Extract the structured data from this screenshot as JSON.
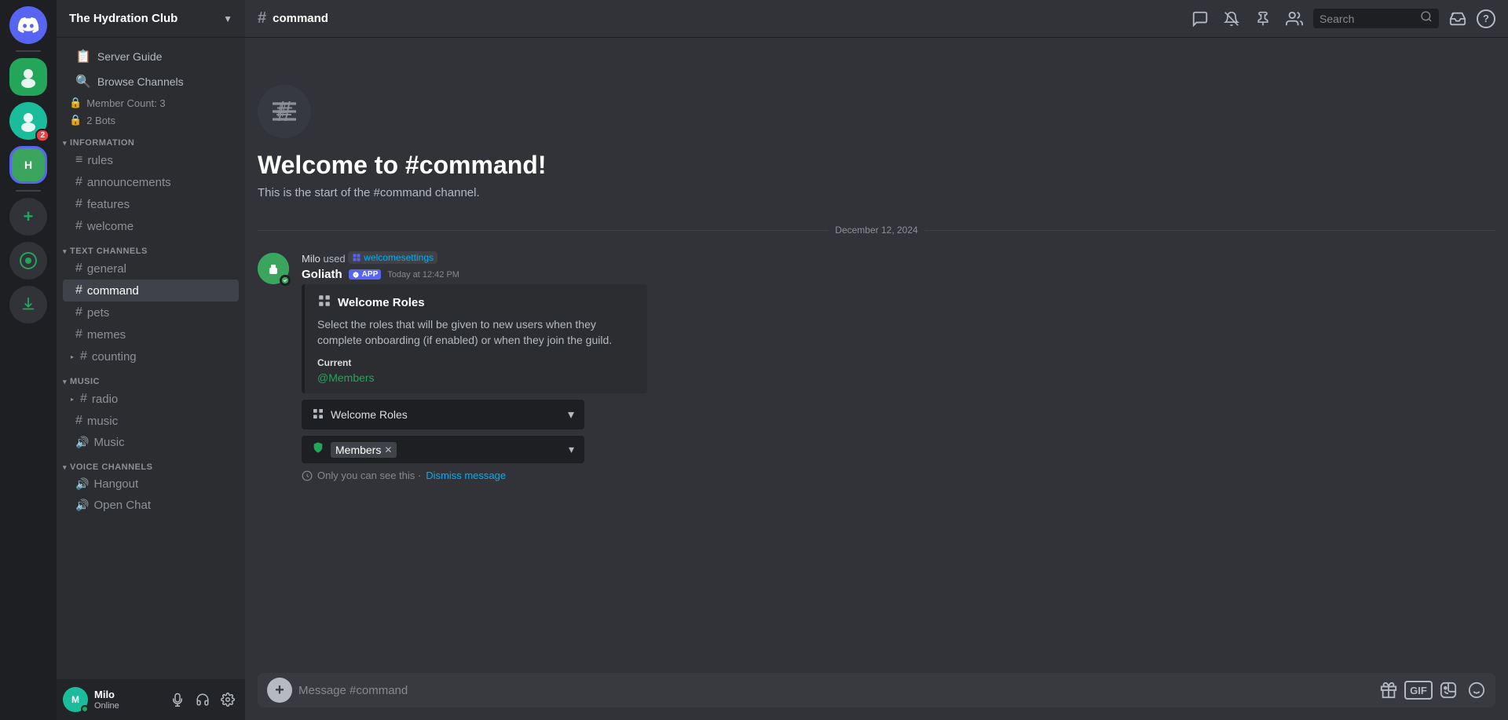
{
  "server": {
    "name": "The Hydration Club",
    "icon_letter": "H",
    "icon_bg": "#5865f2"
  },
  "sidebar": {
    "server_guide": "Server Guide",
    "browse_channels": "Browse Channels",
    "member_count": "Member Count: 3",
    "bots": "2 Bots",
    "categories": {
      "information": "INFORMATION",
      "text_channels": "TEXT CHANNELS",
      "music": "MUSIC",
      "voice_channels": "VOICE CHANNELS"
    },
    "information_channels": [
      "rules",
      "announcements",
      "features",
      "welcome"
    ],
    "text_channels": [
      "general",
      "command",
      "pets",
      "memes",
      "counting"
    ],
    "music_channels": [
      "radio",
      "music",
      "Music"
    ],
    "voice_channels": [
      "Hangout",
      "Open Chat"
    ]
  },
  "topbar": {
    "channel": "command",
    "search_placeholder": "Search"
  },
  "channel": {
    "welcome_title": "Welcome to #command!",
    "welcome_desc": "This is the start of the #command channel."
  },
  "messages": {
    "date_divider": "December 12, 2024",
    "message1": {
      "author": "Goliath",
      "app_badge": "APP",
      "timestamp": "Today at 12:42 PM",
      "system_text": " used ",
      "system_user": "Milo",
      "welcomesettings_link": "welcomesettings"
    }
  },
  "embed": {
    "title": "Welcome Roles",
    "description": "Select the roles that will be given to new users when they complete onboarding (if enabled) or when they join the guild.",
    "current_label": "Current",
    "current_value": "@Members"
  },
  "dropdowns": {
    "welcome_roles": "Welcome Roles",
    "members_tag": "Members"
  },
  "visibility": {
    "prefix": "Only you can see this · ",
    "dismiss_link": "Dismiss message"
  },
  "message_input": {
    "placeholder": "Message #command"
  },
  "user_panel": {
    "name": "Milo",
    "status": "Online"
  },
  "icons": {
    "hash": "#",
    "shield": "🛡",
    "lock": "🔒",
    "speaker": "🔊",
    "settings": "⚙",
    "search": "🔍",
    "inbox": "📥",
    "help": "?",
    "thread": "💬",
    "notification": "🔔",
    "pin": "📌",
    "members": "👥",
    "apps": "🧩",
    "hide": "◁",
    "mic": "🎤",
    "headphones": "🎧",
    "gear": "⚙",
    "gift": "🎁",
    "gif": "GIF",
    "sticker": "😊",
    "emoji": "😊",
    "plus": "+"
  }
}
